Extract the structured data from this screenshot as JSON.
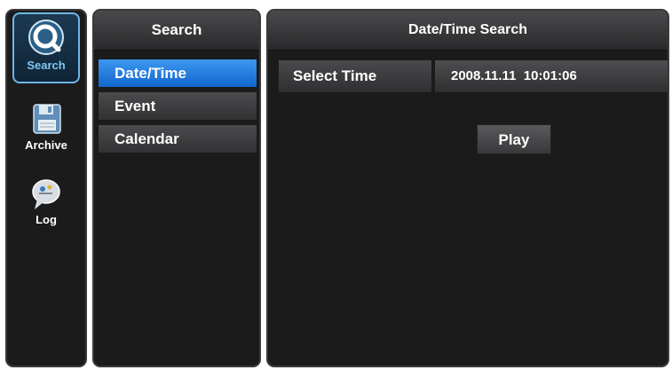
{
  "rail": {
    "items": [
      {
        "label": "Search",
        "icon": "search-icon"
      },
      {
        "label": "Archive",
        "icon": "archive-icon"
      },
      {
        "label": "Log",
        "icon": "log-icon"
      }
    ],
    "active_color": "#7ec8f5"
  },
  "menu": {
    "title": "Search",
    "items": [
      {
        "label": "Date/Time",
        "active": true
      },
      {
        "label": "Event",
        "active": false
      },
      {
        "label": "Calendar",
        "active": false
      }
    ],
    "active_color": "#2a80e0"
  },
  "content": {
    "title": "Date/Time Search",
    "select_time_label": "Select Time",
    "select_time_value": "2008.11.11  10:01:06",
    "play_label": "Play"
  }
}
